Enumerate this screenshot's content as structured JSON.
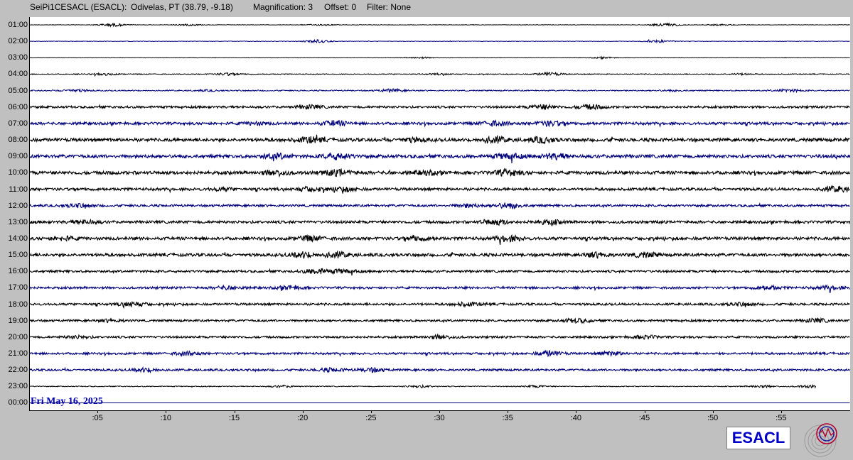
{
  "header": {
    "station": "SeiPi1CESACL (ESACL):",
    "location": "Odivelas, PT (38.79, -9.18)",
    "magnification": "Magnification: 3",
    "offset": "Offset: 0",
    "filter": "Filter: None"
  },
  "date_label": "Fri May 16, 2025",
  "logo_text": "ESACL",
  "colors": {
    "background": "#c0c0c0",
    "trace_black": "#000000",
    "trace_blue": "#00007a",
    "date_text": "#0000b0",
    "logo_text": "#0000c8"
  },
  "chart_data": {
    "type": "line",
    "title": "",
    "xlabel": "",
    "ylabel": "",
    "hour_labels": [
      "01:00",
      "02:00",
      "03:00",
      "04:00",
      "05:00",
      "06:00",
      "07:00",
      "08:00",
      "09:00",
      "10:00",
      "11:00",
      "12:00",
      "13:00",
      "14:00",
      "15:00",
      "16:00",
      "17:00",
      "18:00",
      "19:00",
      "20:00",
      "21:00",
      "22:00",
      "23:00",
      "00:00"
    ],
    "minute_labels": [
      ":05",
      ":10",
      ":15",
      ":20",
      ":25",
      ":30",
      ":35",
      ":40",
      ":45",
      ":50",
      ":55"
    ],
    "minute_values": [
      5,
      10,
      15,
      20,
      25,
      30,
      35,
      40,
      45,
      50,
      55
    ],
    "xlim": [
      0,
      60
    ],
    "series": [
      {
        "hour_label": "01:00",
        "color": "black",
        "noise": 0.3,
        "end_minute": 60,
        "bursts": [
          [
            6,
            2.0
          ],
          [
            11.5,
            1.0
          ],
          [
            21.3,
            0.8
          ],
          [
            46.5,
            2.2
          ],
          [
            50.5,
            0.8
          ]
        ]
      },
      {
        "hour_label": "02:00",
        "color": "blue",
        "noise": 0.3,
        "end_minute": 60,
        "bursts": [
          [
            21,
            2.0
          ],
          [
            46,
            1.5
          ]
        ]
      },
      {
        "hour_label": "03:00",
        "color": "black",
        "noise": 0.3,
        "end_minute": 60,
        "bursts": [
          [
            28.5,
            1.0
          ],
          [
            42,
            1.0
          ]
        ]
      },
      {
        "hour_label": "04:00",
        "color": "black",
        "noise": 0.6,
        "end_minute": 60,
        "bursts": [
          [
            5.5,
            1.2
          ],
          [
            14.5,
            1.5
          ],
          [
            38,
            2.0
          ],
          [
            30,
            0.8
          ],
          [
            52,
            0.8
          ]
        ]
      },
      {
        "hour_label": "05:00",
        "color": "blue",
        "noise": 0.8,
        "end_minute": 60,
        "bursts": [
          [
            3.3,
            1.5
          ],
          [
            26.5,
            1.8
          ],
          [
            55.5,
            1.8
          ],
          [
            13,
            0.8
          ],
          [
            47,
            0.8
          ]
        ]
      },
      {
        "hour_label": "06:00",
        "color": "black",
        "noise": 1.5,
        "end_minute": 60,
        "bursts": [
          [
            20.5,
            2.0
          ],
          [
            37.5,
            2.5
          ],
          [
            41,
            2.8
          ]
        ]
      },
      {
        "hour_label": "07:00",
        "color": "blue",
        "noise": 1.8,
        "end_minute": 60,
        "bursts": [
          [
            22.3,
            2.8
          ],
          [
            34,
            2.8
          ],
          [
            38,
            2.6
          ],
          [
            16.5,
            1.5
          ]
        ]
      },
      {
        "hour_label": "08:00",
        "color": "black",
        "noise": 2.2,
        "end_minute": 60,
        "bursts": [
          [
            20.5,
            3.0
          ],
          [
            34,
            3.4
          ],
          [
            37.5,
            3.0
          ],
          [
            28,
            2.0
          ]
        ]
      },
      {
        "hour_label": "09:00",
        "color": "blue",
        "noise": 2.2,
        "end_minute": 60,
        "bursts": [
          [
            22.5,
            3.5
          ],
          [
            18,
            2.8
          ],
          [
            35,
            3.2
          ],
          [
            38.5,
            3.0
          ]
        ]
      },
      {
        "hour_label": "10:00",
        "color": "black",
        "noise": 2.2,
        "end_minute": 60,
        "bursts": [
          [
            18,
            3.0
          ],
          [
            22.5,
            3.2
          ],
          [
            35,
            3.4
          ],
          [
            29,
            2.0
          ]
        ]
      },
      {
        "hour_label": "11:00",
        "color": "black",
        "noise": 1.8,
        "end_minute": 60,
        "bursts": [
          [
            20.5,
            2.5
          ],
          [
            23,
            2.6
          ],
          [
            59,
            3.2
          ],
          [
            14,
            1.5
          ]
        ]
      },
      {
        "hour_label": "12:00",
        "color": "blue",
        "noise": 1.5,
        "end_minute": 60,
        "bursts": [
          [
            3.5,
            2.2
          ],
          [
            35,
            3.2
          ],
          [
            32,
            2.0
          ]
        ]
      },
      {
        "hour_label": "13:00",
        "color": "black",
        "noise": 1.8,
        "end_minute": 60,
        "bursts": [
          [
            4,
            2.2
          ],
          [
            34,
            3.2
          ],
          [
            38,
            2.5
          ]
        ]
      },
      {
        "hour_label": "14:00",
        "color": "black",
        "noise": 2.0,
        "end_minute": 60,
        "bursts": [
          [
            20.5,
            2.8
          ],
          [
            35,
            3.2
          ],
          [
            28.5,
            2.0
          ],
          [
            2.5,
            2.0
          ]
        ]
      },
      {
        "hour_label": "15:00",
        "color": "black",
        "noise": 2.0,
        "end_minute": 60,
        "bursts": [
          [
            20,
            3.2
          ],
          [
            22.5,
            3.0
          ],
          [
            41.5,
            2.6
          ],
          [
            45,
            2.5
          ]
        ]
      },
      {
        "hour_label": "16:00",
        "color": "black",
        "noise": 1.5,
        "end_minute": 60,
        "bursts": [
          [
            21,
            3.0
          ],
          [
            23,
            2.2
          ]
        ]
      },
      {
        "hour_label": "17:00",
        "color": "blue",
        "noise": 1.5,
        "end_minute": 60,
        "bursts": [
          [
            14.5,
            2.0
          ],
          [
            19,
            2.2
          ],
          [
            54,
            2.2
          ],
          [
            58.5,
            2.0
          ]
        ]
      },
      {
        "hour_label": "18:00",
        "color": "black",
        "noise": 1.5,
        "end_minute": 60,
        "bursts": [
          [
            7.5,
            2.8
          ],
          [
            32,
            2.0
          ],
          [
            52,
            1.8
          ]
        ]
      },
      {
        "hour_label": "19:00",
        "color": "black",
        "noise": 1.4,
        "end_minute": 60,
        "bursts": [
          [
            40,
            2.4
          ],
          [
            57.5,
            2.2
          ],
          [
            6,
            1.5
          ]
        ]
      },
      {
        "hour_label": "20:00",
        "color": "black",
        "noise": 1.4,
        "end_minute": 60,
        "bursts": [
          [
            30,
            2.2
          ],
          [
            45,
            2.0
          ],
          [
            3.5,
            1.5
          ]
        ]
      },
      {
        "hour_label": "21:00",
        "color": "blue",
        "noise": 1.4,
        "end_minute": 60,
        "bursts": [
          [
            11.5,
            2.0
          ],
          [
            38,
            2.8
          ],
          [
            42.5,
            2.2
          ]
        ]
      },
      {
        "hour_label": "22:00",
        "color": "blue",
        "noise": 1.4,
        "end_minute": 60,
        "bursts": [
          [
            8.5,
            2.2
          ],
          [
            25,
            2.5
          ],
          [
            22,
            2.0
          ]
        ]
      },
      {
        "hour_label": "23:00",
        "color": "black",
        "noise": 0.6,
        "end_minute": 57.5,
        "bursts": [
          [
            18.5,
            1.2
          ],
          [
            28.5,
            1.5
          ],
          [
            53.5,
            1.5
          ],
          [
            57,
            1.5
          ],
          [
            37,
            1.2
          ]
        ]
      },
      {
        "hour_label": "00:00",
        "color": "blue",
        "noise": 0,
        "end_minute": 60,
        "bursts": []
      }
    ]
  }
}
